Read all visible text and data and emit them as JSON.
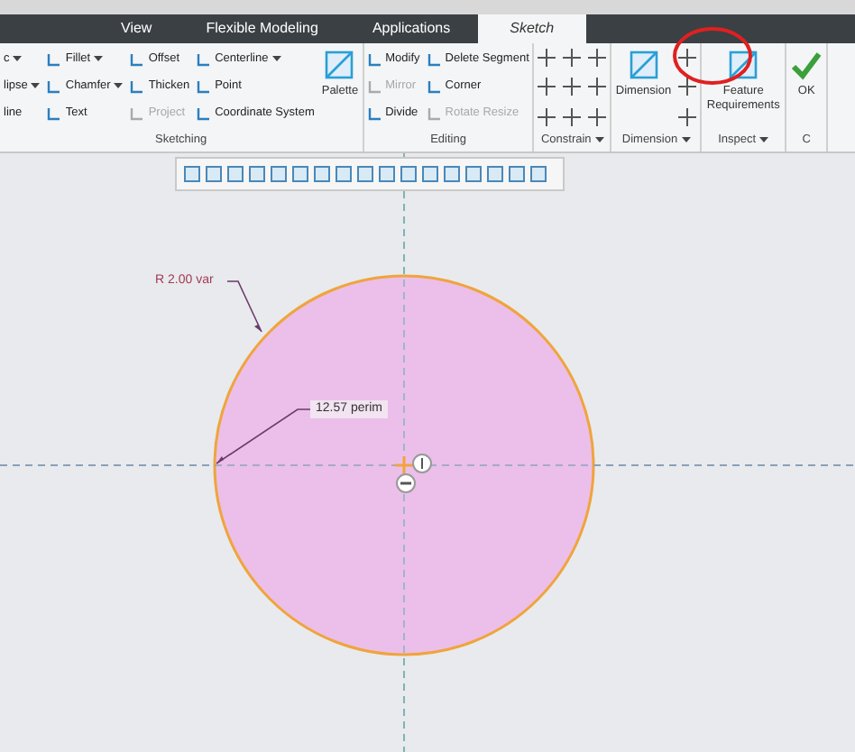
{
  "tabs": [
    {
      "label": "View",
      "selected": false
    },
    {
      "label": "Flexible Modeling",
      "selected": false
    },
    {
      "label": "Applications",
      "selected": false
    },
    {
      "label": "Sketch",
      "selected": true
    }
  ],
  "groups": [
    {
      "label": "Sketching",
      "dropdown": false,
      "columns": [
        {
          "kind": "small",
          "items": [
            {
              "label": "c",
              "dropdown": true,
              "disabled": false
            },
            {
              "label": "lipse",
              "dropdown": true,
              "disabled": false
            },
            {
              "label": "line",
              "dropdown": false,
              "disabled": false
            }
          ]
        },
        {
          "kind": "small",
          "items": [
            {
              "label": "Fillet",
              "dropdown": true,
              "disabled": false
            },
            {
              "label": "Chamfer",
              "dropdown": true,
              "disabled": false
            },
            {
              "label": "Text",
              "dropdown": false,
              "disabled": false
            }
          ]
        },
        {
          "kind": "small",
          "items": [
            {
              "label": "Offset",
              "dropdown": false,
              "disabled": false
            },
            {
              "label": "Thicken",
              "dropdown": false,
              "disabled": false
            },
            {
              "label": "Project",
              "dropdown": false,
              "disabled": true
            }
          ]
        },
        {
          "kind": "small",
          "items": [
            {
              "label": "Centerline",
              "dropdown": true,
              "disabled": false
            },
            {
              "label": "Point",
              "dropdown": false,
              "disabled": false
            },
            {
              "label": "Coordinate System",
              "dropdown": false,
              "disabled": false
            }
          ]
        },
        {
          "kind": "large",
          "label": "Palette"
        }
      ]
    },
    {
      "label": "Editing",
      "dropdown": false,
      "columns": [
        {
          "kind": "small",
          "items": [
            {
              "label": "Modify",
              "dropdown": false,
              "disabled": false
            },
            {
              "label": "Mirror",
              "dropdown": false,
              "disabled": true
            },
            {
              "label": "Divide",
              "dropdown": false,
              "disabled": false
            }
          ]
        },
        {
          "kind": "small",
          "items": [
            {
              "label": "Delete Segment",
              "dropdown": false,
              "disabled": false
            },
            {
              "label": "Corner",
              "dropdown": false,
              "disabled": false
            },
            {
              "label": "Rotate Resize",
              "dropdown": false,
              "disabled": true
            }
          ]
        }
      ]
    },
    {
      "label": "Constrain",
      "dropdown": true,
      "columns": [
        {
          "kind": "constrain_icons"
        }
      ]
    },
    {
      "label": "Dimension",
      "dropdown": true,
      "columns": [
        {
          "kind": "large",
          "label": "Dimension"
        },
        {
          "kind": "dimension_icons"
        }
      ]
    },
    {
      "label": "Inspect",
      "dropdown": true,
      "columns": [
        {
          "kind": "large",
          "label": "Feature Requirements"
        }
      ]
    },
    {
      "label": "C",
      "dropdown": false,
      "columns": [
        {
          "kind": "large",
          "label": "OK"
        }
      ]
    }
  ],
  "canvas": {
    "radius_label": "R 2.00 var",
    "perimeter_label": "12.57 perim"
  }
}
